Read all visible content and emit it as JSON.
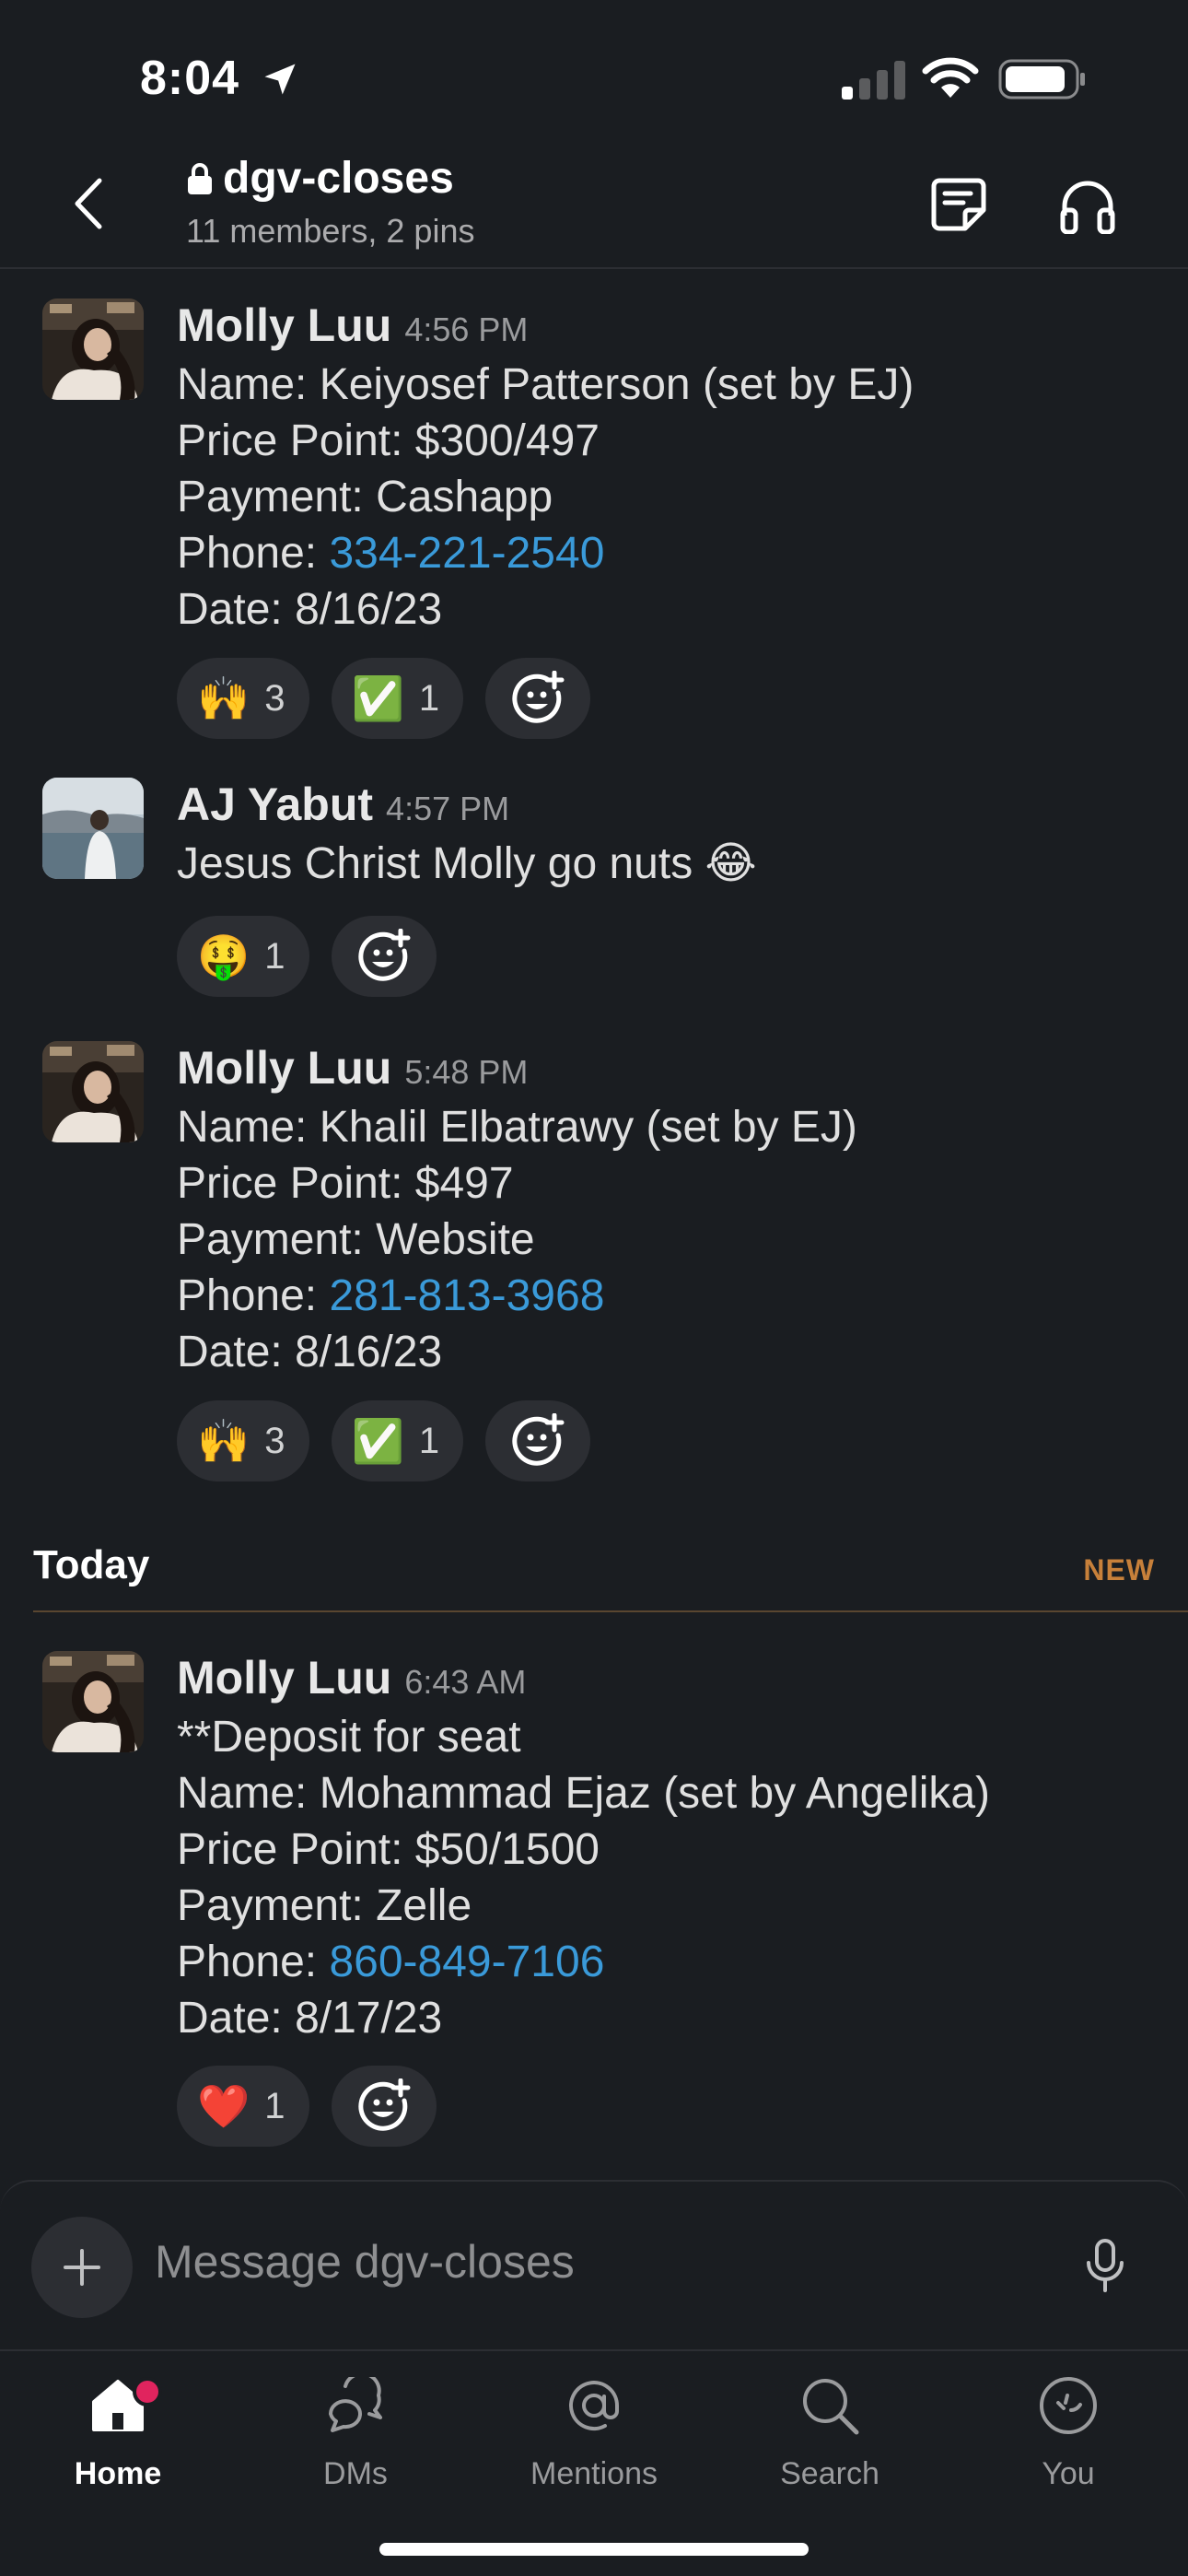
{
  "status_bar": {
    "time": "8:04"
  },
  "header": {
    "channel_name": "dgv-closes",
    "meta": "11 members, 2 pins"
  },
  "messages": [
    {
      "author": "Molly Luu",
      "time": "4:56 PM",
      "lines": [
        {
          "text": "Name: Keiyosef Patterson (set by EJ)"
        },
        {
          "text": "Price Point: $300/497"
        },
        {
          "text": "Payment: Cashapp"
        },
        {
          "prefix": "Phone: ",
          "link": "334-221-2540"
        },
        {
          "text": "Date: 8/16/23"
        }
      ],
      "reactions": [
        {
          "emoji": "🙌",
          "count": "3"
        },
        {
          "emoji": "✅",
          "count": "1"
        }
      ]
    },
    {
      "author": "AJ Yabut",
      "time": "4:57 PM",
      "lines": [
        {
          "text": "Jesus Christ Molly go nuts 😂"
        }
      ],
      "reactions": [
        {
          "emoji": "🤑",
          "count": "1"
        }
      ]
    },
    {
      "author": "Molly Luu",
      "time": "5:48 PM",
      "lines": [
        {
          "text": "Name: Khalil Elbatrawy (set by EJ)"
        },
        {
          "text": "Price Point: $497"
        },
        {
          "text": "Payment: Website"
        },
        {
          "prefix": "Phone: ",
          "link": "281-813-3968"
        },
        {
          "text": "Date: 8/16/23"
        }
      ],
      "reactions": [
        {
          "emoji": "🙌",
          "count": "3"
        },
        {
          "emoji": "✅",
          "count": "1"
        }
      ]
    },
    {
      "author": "Molly Luu",
      "time": "6:43 AM",
      "lines": [
        {
          "text": "**Deposit for seat"
        },
        {
          "text": "Name: Mohammad Ejaz (set by Angelika)"
        },
        {
          "text": "Price Point: $50/1500"
        },
        {
          "text": "Payment: Zelle"
        },
        {
          "prefix": "Phone: ",
          "link": "860-849-7106"
        },
        {
          "text": "Date: 8/17/23"
        }
      ],
      "reactions": [
        {
          "emoji": "❤️",
          "count": "1"
        }
      ]
    }
  ],
  "divider": {
    "label": "Today",
    "new_label": "NEW"
  },
  "composer": {
    "placeholder": "Message dgv-closes"
  },
  "tabs": [
    {
      "label": "Home",
      "icon": "home-icon",
      "active": true
    },
    {
      "label": "DMs",
      "icon": "dms-icon"
    },
    {
      "label": "Mentions",
      "icon": "at-icon"
    },
    {
      "label": "Search",
      "icon": "search-icon"
    },
    {
      "label": "You",
      "icon": "you-icon"
    }
  ],
  "colors": {
    "background": "#1a1d21",
    "link": "#3a9ad9",
    "new_badge": "#c7803a",
    "notification_dot": "#e0245e"
  }
}
